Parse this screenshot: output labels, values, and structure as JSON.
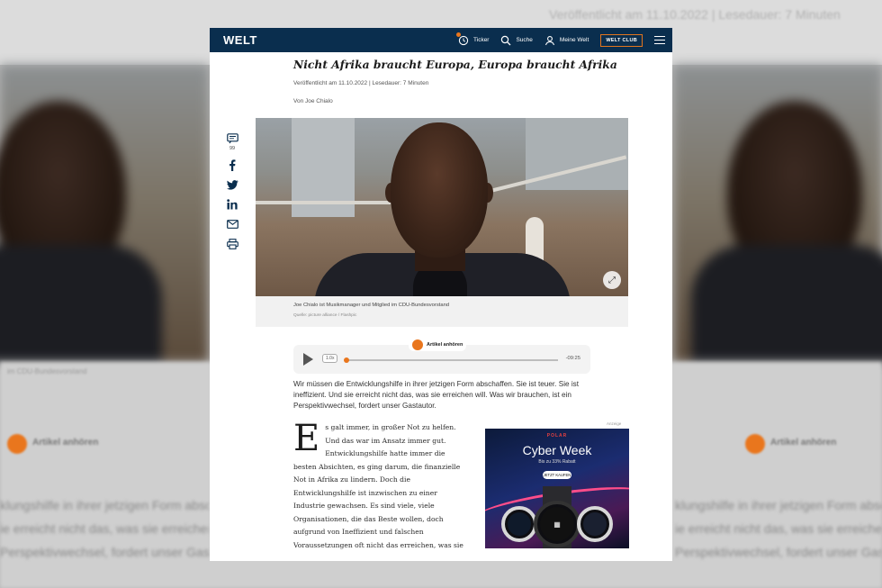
{
  "background": {
    "top_text": "Veröffentlicht am 11.10.2022 | Lesedauer: 7 Minuten",
    "caption_left": "im CDU-Bundesvorstand",
    "audio_label": "Artikel anhören",
    "text_lines_left": [
      "klungshilfe in ihrer jetzigen Form abschaffen",
      "ie erreicht nicht das, was sie erreichen",
      "Perspektivwechsel, fordert unser Gastauto"
    ],
    "text_lines_right": [
      "klungshilfe in ihrer jetzigen Form abschaffen",
      "ie erreicht nicht das, was sie erreichen",
      "Perspektivwechsel, fordert unser Gastautor"
    ]
  },
  "nav": {
    "logo": "WELT",
    "ticker": "Ticker",
    "search": "Suche",
    "account": "Meine Welt",
    "club": "WELT CLUB",
    "brand_color": "#0a2e4e",
    "accent_color": "#e9761d"
  },
  "article": {
    "headline": "Nicht Afrika braucht Europa, Europa braucht Afrika",
    "meta": "Veröffentlicht am 11.10.2022 | Lesedauer: 7 Minuten",
    "author": "Von Joe Chialo",
    "comment_count": "99",
    "caption": "Joe Chialo ist Musikmanager und Mitglied im CDU-Bundesvorstand",
    "caption_source": "Quelle: picture alliance / Flashpic",
    "teaser": "Wir müssen die Entwicklungshilfe in ihrer jetzigen Form abschaffen. Sie ist teuer. Sie ist ineffizient. Und sie erreicht nicht das, was sie erreichen will. Was wir brauchen, ist ein Perspektivwechsel, fordert unser Gastautor.",
    "dropcap": "E",
    "body": "s galt immer, in großer Not zu helfen. Und das war im Ansatz immer gut. Entwicklungshilfe hatte immer die besten Absichten, es ging darum, die finanzielle Not in Afrika zu lindern. Doch die Entwicklungshilfe ist inzwischen zu einer Industrie gewachsen. Es sind viele, viele Organisationen, die das Beste wollen, doch aufgrund von Ineffizient und falschen Voraussetzungen oft nicht das erreichen, was sie"
  },
  "audio": {
    "label": "Artikel anhören",
    "speed": "1.0x",
    "remaining": "-09:25",
    "progress": 0.0
  },
  "share_icons": [
    "comment-icon",
    "facebook-icon",
    "twitter-icon",
    "linkedin-icon",
    "mail-icon",
    "print-icon"
  ],
  "ad": {
    "label": "Anzeige",
    "brand": "POLAR",
    "title": "Cyber Week",
    "subtitle": "Bis zu 33% Rabatt",
    "cta": "JETZT KAUFEN"
  }
}
